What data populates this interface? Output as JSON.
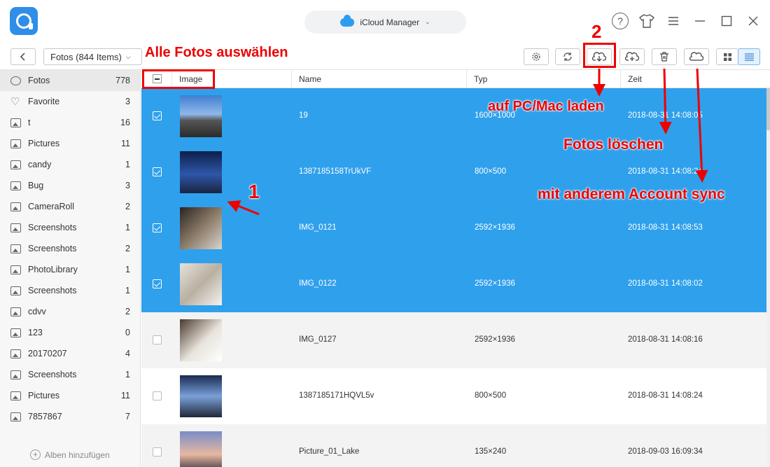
{
  "app": {
    "title": "iCloud Manager",
    "window_controls": [
      "help-icon",
      "skin-icon",
      "menu-icon",
      "minimize-icon",
      "maximize-icon",
      "close-icon"
    ]
  },
  "toolbar": {
    "category_select": "Fotos (844 Items)",
    "buttons": [
      "settings-icon",
      "refresh-icon",
      "download-to-computer-icon",
      "upload-icon",
      "delete-icon",
      "sync-cloud-icon",
      "grid-view-icon",
      "list-view-icon"
    ]
  },
  "sidebar": {
    "items": [
      {
        "label": "Fotos",
        "count": "778",
        "icon": "gear-icon"
      },
      {
        "label": "Favorite",
        "count": "3",
        "icon": "heart-icon"
      },
      {
        "label": "t",
        "count": "16",
        "icon": "album-icon"
      },
      {
        "label": "Pictures",
        "count": "11",
        "icon": "album-icon"
      },
      {
        "label": "candy",
        "count": "1",
        "icon": "album-icon"
      },
      {
        "label": "Bug",
        "count": "3",
        "icon": "album-icon"
      },
      {
        "label": "CameraRoll",
        "count": "2",
        "icon": "album-icon"
      },
      {
        "label": "Screenshots",
        "count": "1",
        "icon": "album-icon"
      },
      {
        "label": "Screenshots",
        "count": "2",
        "icon": "album-icon"
      },
      {
        "label": "PhotoLibrary",
        "count": "1",
        "icon": "album-icon"
      },
      {
        "label": "Screenshots",
        "count": "1",
        "icon": "album-icon"
      },
      {
        "label": "cdvv",
        "count": "2",
        "icon": "album-icon"
      },
      {
        "label": "123",
        "count": "0",
        "icon": "album-icon"
      },
      {
        "label": "20170207",
        "count": "4",
        "icon": "album-icon"
      },
      {
        "label": "Screenshots",
        "count": "1",
        "icon": "album-icon"
      },
      {
        "label": "Pictures",
        "count": "11",
        "icon": "album-icon"
      },
      {
        "label": "7857867",
        "count": "7",
        "icon": "album-icon"
      }
    ],
    "add_album": "Alben hinzufügen"
  },
  "table": {
    "columns": [
      "Image",
      "Name",
      "Typ",
      "Zeit"
    ],
    "rows": [
      {
        "name": "19",
        "typ": "1600×1000",
        "zeit": "2018-08-31 14:08:05",
        "selected": true
      },
      {
        "name": "1387185158TrUkVF",
        "typ": "800×500",
        "zeit": "2018-08-31 14:08:24",
        "selected": true
      },
      {
        "name": "IMG_0121",
        "typ": "2592×1936",
        "zeit": "2018-08-31 14:08:53",
        "selected": true
      },
      {
        "name": "IMG_0122",
        "typ": "2592×1936",
        "zeit": "2018-08-31 14:08:02",
        "selected": true
      },
      {
        "name": "IMG_0127",
        "typ": "2592×1936",
        "zeit": "2018-08-31 14:08:16",
        "selected": false
      },
      {
        "name": "1387185171HQVL5v",
        "typ": "800×500",
        "zeit": "2018-08-31 14:08:24",
        "selected": false
      },
      {
        "name": "Picture_01_Lake",
        "typ": "135×240",
        "zeit": "2018-09-03 16:09:34",
        "selected": false
      }
    ]
  },
  "annotations": {
    "select_all": "Alle Fotos auswählen",
    "step1": "1",
    "step2": "2",
    "download": "auf PC/Mac laden",
    "delete": "Fotos löschen",
    "sync": "mit anderem Account sync"
  },
  "colors": {
    "accent": "#2fa0ec",
    "annotation": "#e00000"
  }
}
